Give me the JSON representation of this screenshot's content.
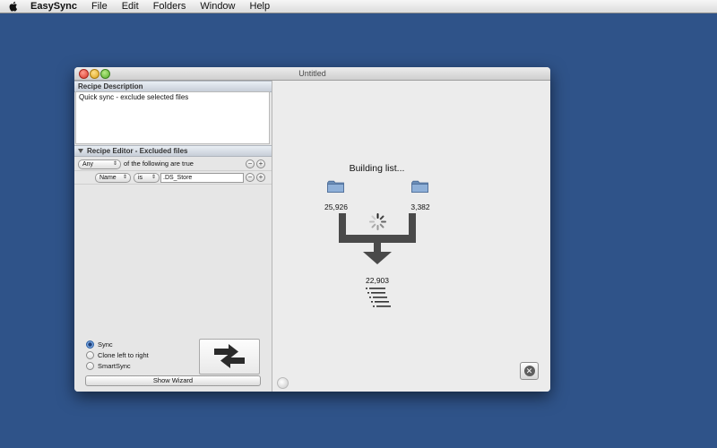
{
  "menubar": {
    "app_name": "EasySync",
    "items": [
      "File",
      "Edit",
      "Folders",
      "Window",
      "Help"
    ]
  },
  "window": {
    "title": "Untitled"
  },
  "recipe": {
    "description_header": "Recipe Description",
    "description_text": "Quick sync - exclude selected files",
    "editor_header": "Recipe Editor - Excluded files",
    "match_value": "Any",
    "match_suffix": "of the following are true",
    "rule": {
      "field": "Name",
      "operator": "is",
      "value": ".DS_Store"
    }
  },
  "modes": {
    "options": [
      "Sync",
      "Clone left to right",
      "SmartSync"
    ],
    "selected": "Sync"
  },
  "wizard_label": "Show Wizard",
  "progress": {
    "status": "Building list...",
    "left_count": "25,926",
    "right_count": "3,382",
    "result_count": "22,903"
  },
  "icons": {
    "apple": "apple-logo-icon",
    "folder": "folder-icon",
    "spinner": "spinner-icon",
    "merge": "merge-arrow-icon",
    "list": "list-icon",
    "swap": "swap-arrows-icon",
    "cancel": "cancel-icon"
  }
}
